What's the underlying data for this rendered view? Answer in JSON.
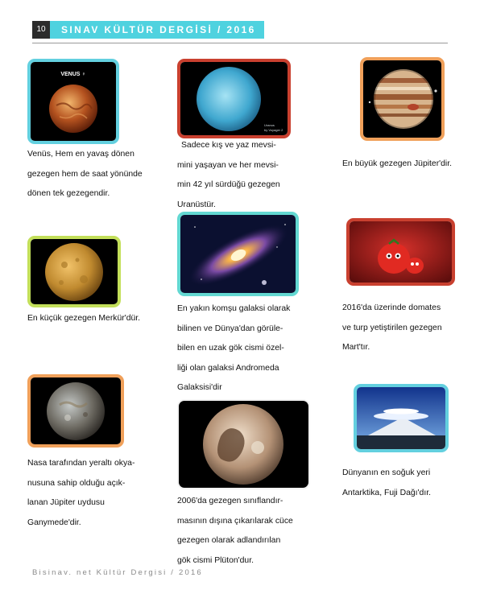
{
  "header": {
    "page_number": "10",
    "title": "SINAV KÜLTÜR DERGİSİ / 2016"
  },
  "images": {
    "venus": {
      "label": "VENUS ♀"
    },
    "uranus": {
      "credit_line1": "Uranus",
      "credit_line2": "by Voyager 2"
    }
  },
  "captions": {
    "venus": [
      "Venüs, Hem en yavaş dönen",
      "gezegen hem de saat yönünde",
      "dönen tek gezegendir."
    ],
    "uranus": [
      "Sadece kış ve yaz mevsi-",
      "mini yaşayan ve her mevsi-",
      "min 42 yıl sürdüğü gezegen",
      "Uranüstür."
    ],
    "jupiter": [
      "En büyük gezegen Jüpiter'dir."
    ],
    "mercury": [
      "En küçük gezegen Merkür'dür."
    ],
    "andromeda": [
      "En yakın komşu galaksi olarak",
      "bilinen ve Dünya'dan görüle-",
      "bilen en uzak gök cismi özel-",
      "liği olan galaksi Andromeda",
      "Galaksisi'dir"
    ],
    "mars": [
      "2016'da üzerinde domates",
      "ve turp yetiştirilen gezegen",
      "Mart'tır."
    ],
    "ganymede": [
      "Nasa tarafından yeraltı okya-",
      "nusuna sahip olduğu açık-",
      "lanan Jüpiter uydusu",
      "Ganymede'dir."
    ],
    "pluto": [
      "2006'da gezegen sınıflandır-",
      "masının dışına çıkarılarak cüce",
      "gezegen olarak adlandırılan",
      "gök cismi Plüton'dur."
    ],
    "fuji": [
      "Dünyanın en soğuk yeri",
      "Antarktika, Fuji Dağı'dır."
    ]
  },
  "footer": {
    "text": "Bisinav. net Kültür Dergisi / 2016"
  },
  "colors": {
    "header_bar": "#4fd2df",
    "page_number_box": "#2c2c2c",
    "frame_blue": "#63d0df",
    "frame_red": "#c9402f",
    "frame_orange": "#f0a05a",
    "frame_lime": "#c3df5a",
    "frame_teal": "#63d8d2"
  }
}
